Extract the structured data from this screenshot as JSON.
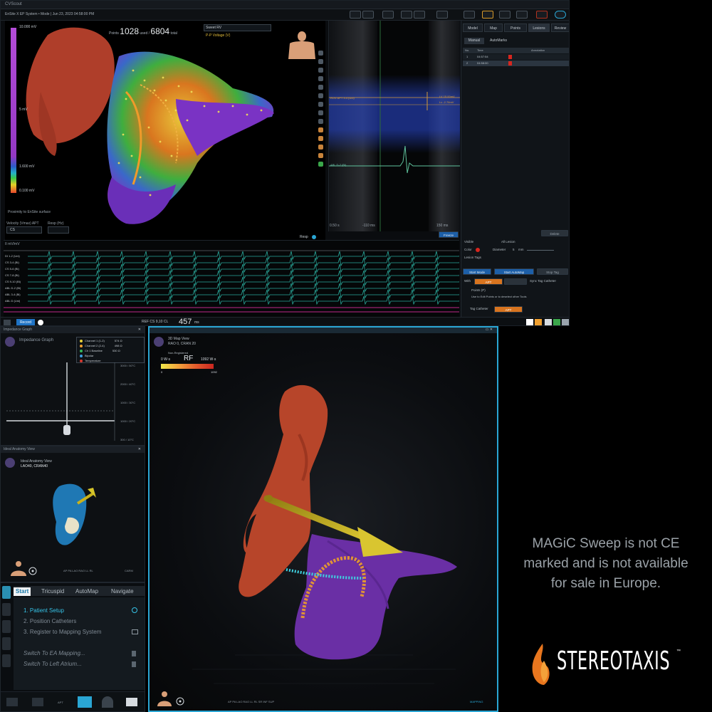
{
  "window": {
    "title": "CVScout",
    "status_text": "EnSite X EP System • Mode | Jun 23, 2023 04:58:00 PM"
  },
  "map3d": {
    "points_label": "Points",
    "points_used": "1028",
    "used_label": "used /",
    "points_total": "6804",
    "total_label": "total",
    "dropdown_value": "Sweet RV",
    "sub_label": "P-P Voltage (V)",
    "vbar_top": "10.000 mV",
    "vbar_mid": "5 mV",
    "vbar_low1": "1.600 mV",
    "vbar_low2": "0.100 mV",
    "proximity_label": "Proximity to EnSite surface",
    "velocity_label": "Velocity (Vmax) APT",
    "velocity_value": "CS",
    "resp_label": "Resp (Hz)",
    "resp_button": "Resp"
  },
  "zoom_ecg": {
    "roving_label": "ROV APT 3.4 (Uni)",
    "ablation_label": "ABL D-2 (Bi)",
    "time_left": "0.50 s",
    "time_mid": "-110 ms",
    "time_right": "150 ms",
    "ref_label_1": "LV 15.00mV",
    "ref_label_2": "Lv -2.76mV",
    "freeze_button": "Freeze"
  },
  "right_panel": {
    "tabs": [
      "Model",
      "Map",
      "Points",
      "Lesions",
      "Review"
    ],
    "active_tab": "Lesions",
    "subtabs": [
      "Manual",
      "AutoMarks"
    ],
    "columns": [
      "No.",
      "Time",
      "Annotation"
    ],
    "lesions": [
      {
        "no": "1",
        "time": "04:57:54"
      },
      {
        "no": "2",
        "time": "04:58:00"
      }
    ],
    "delete_button": "Delete",
    "visible_label": "Visible",
    "show_all_label": "All Lesion",
    "color_label": "Color",
    "diameter_label": "Diameter",
    "diameter_value": "5",
    "diameter_unit": "mm",
    "lesion_tags_label": "Lesion Tags",
    "start_mode_button": "Start Mode",
    "start_autotag_button": "Start AutoMap",
    "stop_button": "Stop Tag",
    "with_label": "With",
    "with_value": "APT",
    "sync_label": "Sync Tag Catheter",
    "points_dropdown": "Points (P)",
    "hint_text": "Use to Edit Points or to deselect other Tools",
    "tag_catheter_label": "Tag Catheter",
    "tag_catheter_value": "APT"
  },
  "ecg_strip": {
    "header": "II mV/mV",
    "channels": [
      "DI 1-2 (Uni)",
      "CS 3-4 (Bi)",
      "CS 5-6 (Bi)",
      "CS 7-8 (Bi)",
      "CS 9-10 (Bi)",
      "ABL D-2 (Bi)",
      "ABL 3-4 (Bi)",
      "ABL D (Uni)"
    ]
  },
  "bottom_bar": {
    "record_button": "Record",
    "ref_label": "REF CS 9,10 CL",
    "cl_value": "457",
    "cl_unit": "ms"
  },
  "impedance": {
    "panel_title": "Impedance Graph",
    "view_title": "Impedance Graph",
    "legend": [
      {
        "label": "Channel 1 (1-2)",
        "value": "574 Ω",
        "color": "#e8d23a"
      },
      {
        "label": "Channel 2 (2-4)",
        "value": "498 Ω",
        "color": "#f0a030"
      },
      {
        "label": "Ch 1 Baseline",
        "value": "530 Ω",
        "color": "#36b85a"
      },
      {
        "label": "Bipolar",
        "value": "",
        "color": "#3fa0e0"
      },
      {
        "label": "Temperature",
        "value": "",
        "color": "#d9392e"
      }
    ],
    "axis_labels": [
      "3000 / 50°C",
      "2000 / 40°C",
      "1000 / 30°C",
      "1000 / 20°C",
      "300 / 10°C"
    ]
  },
  "anatomy": {
    "panel_title": "Ideal Anatomy View",
    "view_title": "Ideal Anatomy View",
    "view_sub": "LAO40, CRAN40",
    "bottom_text": "AP PA LAO RAO LL RL",
    "bottom_right": "CARM"
  },
  "workflow": {
    "tabs": [
      "Start",
      "Tricuspid",
      "AutoMap",
      "Navigate"
    ],
    "active_tab": "Start",
    "steps": [
      {
        "num": "1.",
        "label": "Patient Setup"
      },
      {
        "num": "2.",
        "label": "Position Catheters"
      },
      {
        "num": "3.",
        "label": "Register to Mapping System"
      }
    ],
    "actions": [
      "Switch To EA Mapping...",
      "Switch To Left Atrium..."
    ],
    "footer_label": "APT"
  },
  "map_view": {
    "title": "3D Map View",
    "subtitle": "RAO 0, CRAN 20",
    "dataset": "Non-Registered",
    "time_left": "0 W·s",
    "rf_label": "RF",
    "time_right": "1092 W·s",
    "scale_min": "0",
    "scale_max": "1092",
    "bottom_text": "AP PA LAO RAO LL RL SR INF SUP",
    "corner_text": "MAPPING"
  },
  "disclaimer": "MAGiC Sweep is not CE marked and is not available for sale in Europe.",
  "logo": {
    "text": "STEREOTAXIS",
    "tm": "™"
  }
}
